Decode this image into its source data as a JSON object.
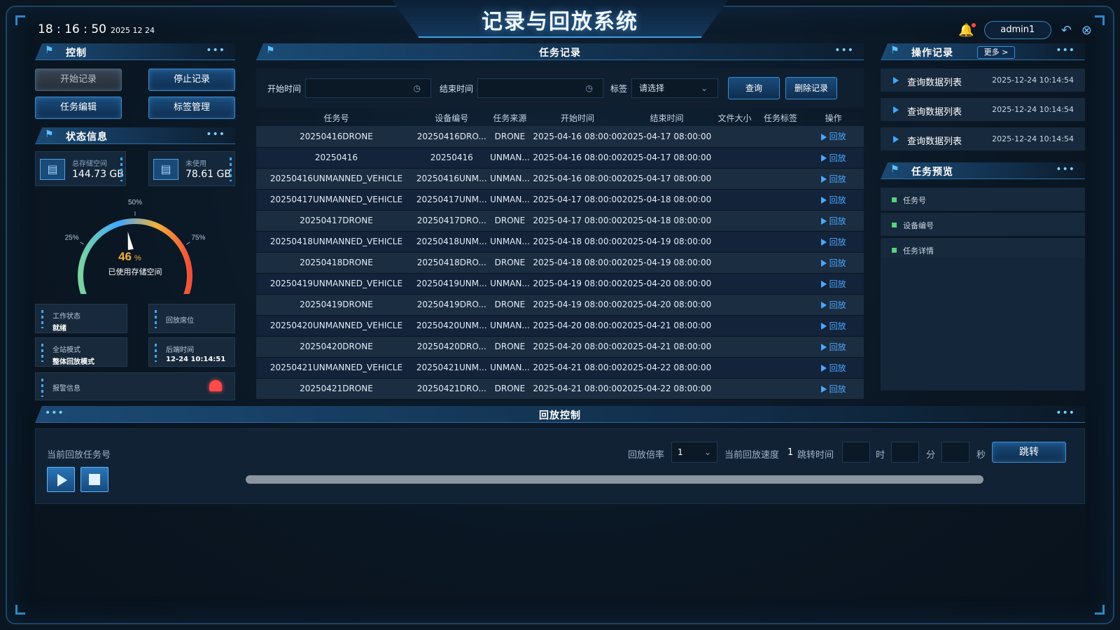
{
  "header": {
    "title": "记录与回放系统",
    "time": "18 : 16 : 50",
    "date": "2025  12  24",
    "username": "admin1"
  },
  "control": {
    "section_title": "控制",
    "start_record": "开始记录",
    "stop_record": "停止记录",
    "task_edit": "任务编辑",
    "tag_manage": "标签管理"
  },
  "status": {
    "section_title": "状态信息",
    "total_storage_label": "总存储空间",
    "total_storage_value": "144.73 GB",
    "unused_label": "未使用",
    "unused_value": "78.61 GB",
    "gauge": {
      "percent": 46,
      "percent_value": "46",
      "percent_unit": "%",
      "caption": "已使用存储空间",
      "ticks": [
        "0%",
        "25%",
        "50%",
        "75%",
        "100%"
      ]
    },
    "work_state_label": "工作状态",
    "work_state_value": "就绪",
    "playback_seat_label": "回放席位",
    "playback_seat_value": "",
    "station_mode_label": "全站模式",
    "station_mode_value": "整体回放模式",
    "later_time_label": "后端时间",
    "later_time_value": "12-24 10:14:51",
    "alarm_label": "报警信息"
  },
  "tasks": {
    "section_title": "任务记录",
    "filters": {
      "start_label": "开始时间",
      "end_label": "结束时间",
      "tag_label": "标签",
      "tag_placeholder": "请选择",
      "query_button": "查询",
      "delete_button": "删除记录"
    },
    "columns": [
      "任务号",
      "设备编号",
      "任务来源",
      "开始时间",
      "结束时间",
      "文件大小",
      "任务标签",
      "操作"
    ],
    "action_label": "回放",
    "rows": [
      [
        "20250416DRONE",
        "20250416DRO...",
        "DRONE",
        "2025-04-16 08:00:00",
        "2025-04-17 08:00:00",
        "",
        ""
      ],
      [
        "20250416",
        "20250416",
        "UNMAN...",
        "2025-04-16 08:00:00",
        "2025-04-17 08:00:00",
        "",
        ""
      ],
      [
        "20250416UNMANNED_VEHICLE",
        "20250416UNM...",
        "UNMAN...",
        "2025-04-16 08:00:00",
        "2025-04-17 08:00:00",
        "",
        ""
      ],
      [
        "20250417UNMANNED_VEHICLE",
        "20250417UNM...",
        "UNMAN...",
        "2025-04-17 08:00:00",
        "2025-04-18 08:00:00",
        "",
        ""
      ],
      [
        "20250417DRONE",
        "20250417DRO...",
        "DRONE",
        "2025-04-17 08:00:00",
        "2025-04-18 08:00:00",
        "",
        ""
      ],
      [
        "20250418UNMANNED_VEHICLE",
        "20250418UNM...",
        "UNMAN...",
        "2025-04-18 08:00:00",
        "2025-04-19 08:00:00",
        "",
        ""
      ],
      [
        "20250418DRONE",
        "20250418DRO...",
        "DRONE",
        "2025-04-18 08:00:00",
        "2025-04-19 08:00:00",
        "",
        ""
      ],
      [
        "20250419UNMANNED_VEHICLE",
        "20250419UNM...",
        "UNMAN...",
        "2025-04-19 08:00:00",
        "2025-04-20 08:00:00",
        "",
        ""
      ],
      [
        "20250419DRONE",
        "20250419DRO...",
        "DRONE",
        "2025-04-19 08:00:00",
        "2025-04-20 08:00:00",
        "",
        ""
      ],
      [
        "20250420UNMANNED_VEHICLE",
        "20250420UNM...",
        "UNMAN...",
        "2025-04-20 08:00:00",
        "2025-04-21 08:00:00",
        "",
        ""
      ],
      [
        "20250420DRONE",
        "20250420DRO...",
        "DRONE",
        "2025-04-20 08:00:00",
        "2025-04-21 08:00:00",
        "",
        ""
      ],
      [
        "20250421UNMANNED_VEHICLE",
        "20250421UNM...",
        "UNMAN...",
        "2025-04-21 08:00:00",
        "2025-04-22 08:00:00",
        "",
        ""
      ],
      [
        "20250421DRONE",
        "20250421DRO...",
        "DRONE",
        "2025-04-21 08:00:00",
        "2025-04-22 08:00:00",
        "",
        ""
      ]
    ]
  },
  "operations": {
    "section_title": "操作记录",
    "more_button": "更多 >",
    "items": [
      {
        "name": "查询数据列表",
        "time": "2025-12-24 10:14:54"
      },
      {
        "name": "查询数据列表",
        "time": "2025-12-24 10:14:54"
      },
      {
        "name": "查询数据列表",
        "time": "2025-12-24 10:14:54"
      }
    ]
  },
  "preview": {
    "section_title": "任务预览",
    "items": [
      "任务号",
      "设备编号",
      "任务详情"
    ]
  },
  "playback": {
    "section_title": "回放控制",
    "current_task_label": "当前回放任务号",
    "rate_label": "回放倍率",
    "rate_value": "1",
    "speed_label": "当前回放速度",
    "speed_value": "1",
    "jump_label": "跳转时间",
    "hour_unit": "时",
    "minute_unit": "分",
    "second_unit": "秒",
    "jump_button": "跳转",
    "progress": 0
  },
  "colors": {
    "accent": "#3fa9ff",
    "gauge_low": "#7ad3a0",
    "gauge_mid": "#f3b13a",
    "gauge_high": "#f0513a",
    "alarm": "#ff4a4a"
  },
  "icons": {
    "bell": "bell-icon",
    "undo": "undo-icon",
    "logout": "logout-icon",
    "disk": "disk-icon",
    "clock": "clock-icon",
    "alarm": "alarm-light-icon",
    "play": "play-icon",
    "stop": "stop-icon"
  }
}
